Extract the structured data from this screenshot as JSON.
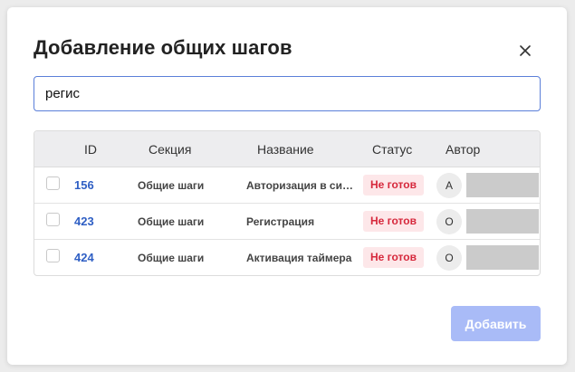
{
  "dialog": {
    "title": "Добавление общих шагов",
    "close_icon": "close-icon",
    "search": {
      "value": "регис",
      "placeholder": ""
    },
    "table": {
      "columns": {
        "id": "ID",
        "section": "Секция",
        "name": "Название",
        "status": "Статус",
        "author": "Автор"
      },
      "rows": [
        {
          "id": "156",
          "section": "Общие шаги",
          "name": "Авторизация в системе",
          "status": "Не готов",
          "author_initial": "А"
        },
        {
          "id": "423",
          "section": "Общие шаги",
          "name": "Регистрация",
          "status": "Не готов",
          "author_initial": "О"
        },
        {
          "id": "424",
          "section": "Общие шаги",
          "name": "Активация таймера",
          "status": "Не готов",
          "author_initial": "О"
        }
      ]
    },
    "add_button": "Добавить",
    "colors": {
      "accent": "#2f5fc4",
      "input_border": "#5b7fd9",
      "button_disabled": "#a9bbf7",
      "status_bg": "#fde7e9",
      "status_text": "#d6283c"
    }
  }
}
